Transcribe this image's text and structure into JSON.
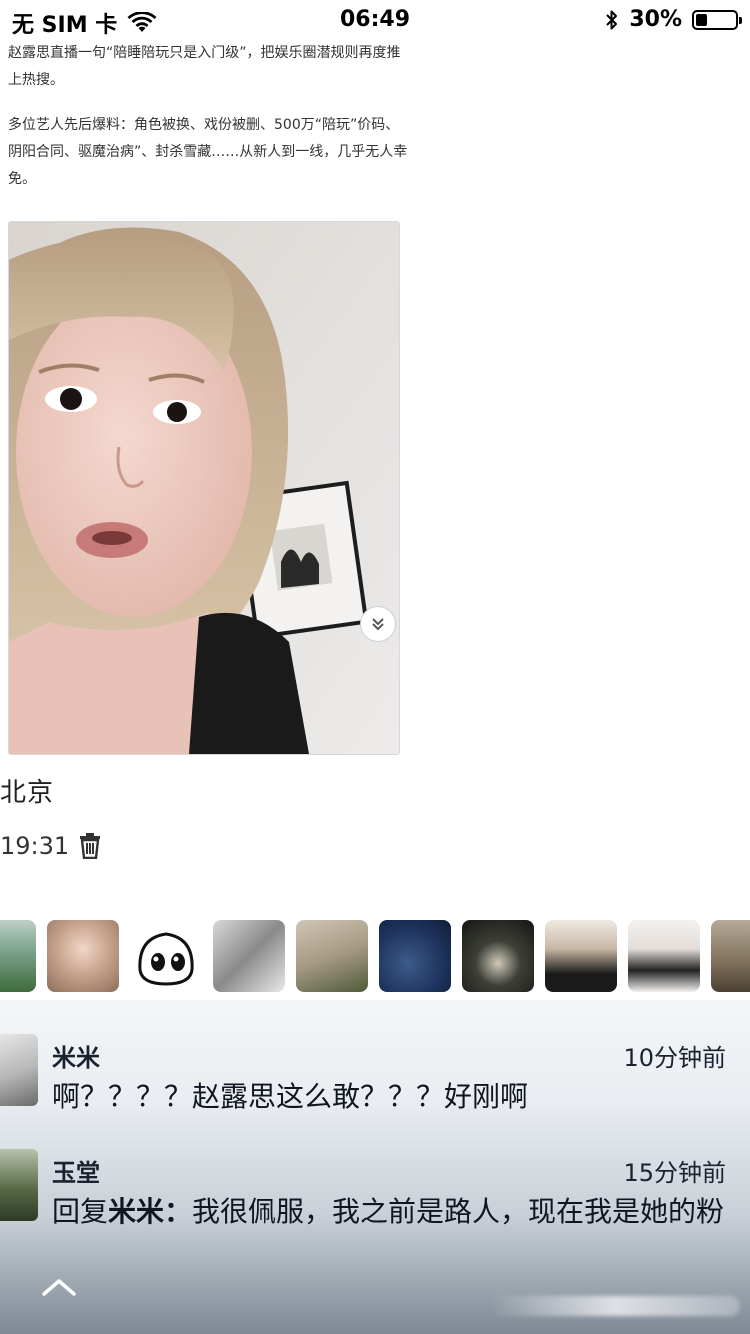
{
  "status_bar": {
    "carrier": "无 SIM 卡",
    "time": "06:49",
    "battery_percent": "30%",
    "battery_level": 0.3
  },
  "article": {
    "paragraph1": "赵露思直播一句“陪睡陪玩只是入门级”，把娱乐圈潜规则再度推上热搜。",
    "paragraph2": "多位艺人先后爆料：角色被换、戏份被删、500万“陪玩”价码、阴阳合同、驱魔治病”、封杀雪藏……从新人到一线，几乎无人幸免。"
  },
  "post": {
    "location": "北京",
    "timestamp": "19:31"
  },
  "comments": [
    {
      "name": "米米",
      "time": "10分钟前",
      "text": "啊？？？？赵露思这么敢？？？好刚啊"
    },
    {
      "name": "玉堂",
      "time": "15分钟前",
      "reply_prefix": "回复",
      "reply_to": "米米",
      "reply_sep": "：",
      "text": "我很佩服，我之前是路人，现在我是她的粉"
    }
  ],
  "icons": {
    "wifi": "wifi-icon",
    "bluetooth": "bluetooth-icon",
    "battery": "battery-icon",
    "delete": "trash-icon",
    "expand": "chevron-double-down-icon",
    "collapse": "chevron-up-icon"
  }
}
